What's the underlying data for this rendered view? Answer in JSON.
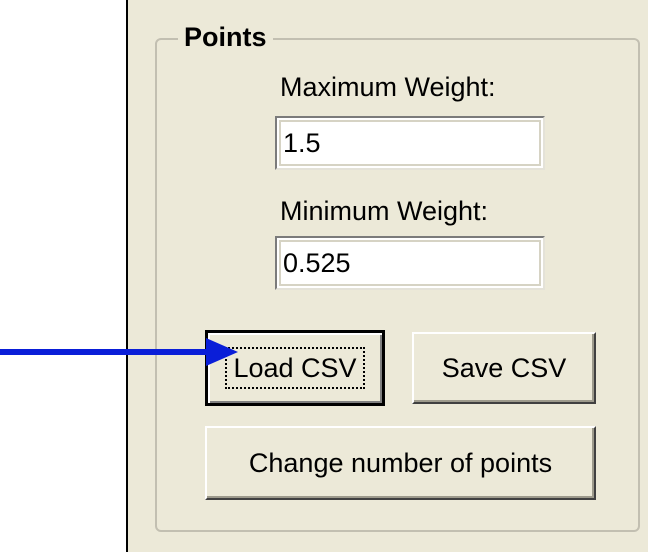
{
  "points_group": {
    "title": "Points",
    "max_weight": {
      "label": "Maximum Weight:",
      "value": "1.5"
    },
    "min_weight": {
      "label": "Minimum Weight:",
      "value": "0.525"
    },
    "buttons": {
      "load_csv": "Load CSV",
      "save_csv": "Save CSV",
      "change_points": "Change number of points"
    }
  },
  "annotation": {
    "arrow_color": "#0a1ed8",
    "arrow_target": "load-csv-button"
  }
}
